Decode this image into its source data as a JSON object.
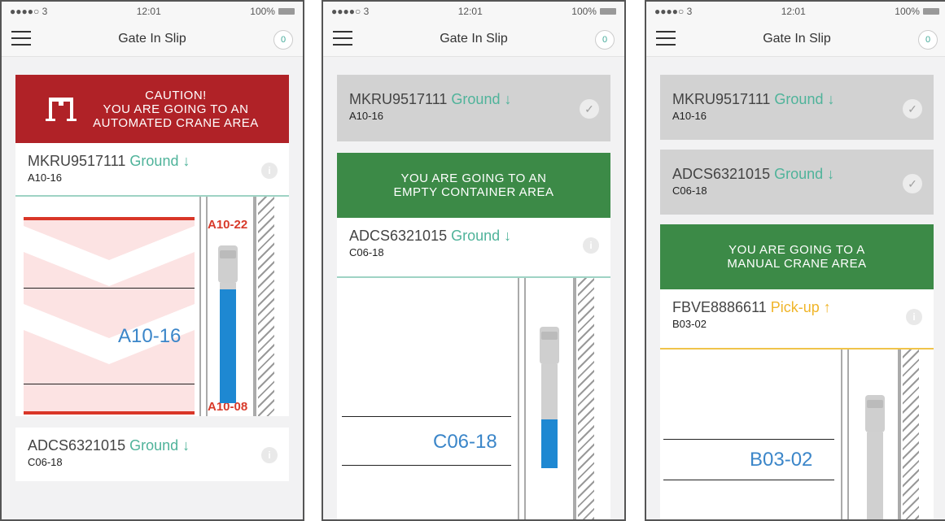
{
  "status": {
    "carrier": "●●●●○ 3",
    "time": "12:01",
    "battery": "100%"
  },
  "header": {
    "title": "Gate In Slip",
    "badge": "0"
  },
  "screens": [
    {
      "banner": {
        "line1": "CAUTION!",
        "line2": "YOU ARE GOING TO AN",
        "line3": "AUTOMATED CRANE AREA",
        "color": "#b02227"
      },
      "card": {
        "container": "MKRU9517111",
        "mode": "Ground ↓",
        "location": "A10-16"
      },
      "map": {
        "target": "A10-16",
        "upper": "A10-22",
        "lower": "A10-08"
      },
      "next_card": {
        "container": "ADCS6321015",
        "mode": "Ground ↓",
        "location": "C06-18"
      }
    },
    {
      "done_card": {
        "container": "MKRU9517111",
        "mode": "Ground ↓",
        "location": "A10-16"
      },
      "banner": {
        "line1": "YOU ARE GOING TO AN",
        "line2": "EMPTY CONTAINER AREA",
        "color": "#3c8a47"
      },
      "card": {
        "container": "ADCS6321015",
        "mode": "Ground ↓",
        "location": "C06-18"
      },
      "map": {
        "target": "C06-18"
      }
    },
    {
      "done_cards": [
        {
          "container": "MKRU9517111",
          "mode": "Ground ↓",
          "location": "A10-16"
        },
        {
          "container": "ADCS6321015",
          "mode": "Ground ↓",
          "location": "C06-18"
        }
      ],
      "banner": {
        "line1": "YOU ARE GOING TO A",
        "line2": "MANUAL CRANE AREA",
        "color": "#3c8a47"
      },
      "card": {
        "container": "FBVE8886611",
        "mode": "Pick-up ↑",
        "location": "B03-02"
      },
      "map": {
        "target": "B03-02"
      }
    }
  ],
  "icons": {
    "menu": "hamburger-icon",
    "info": "info-icon",
    "check": "check-icon",
    "crane": "crane-icon",
    "truck": "truck-icon"
  },
  "colors": {
    "ground": "#4fb39a",
    "pickup": "#f0b529",
    "caution": "#b02227",
    "go": "#3c8a47",
    "container": "#1e88d2"
  }
}
